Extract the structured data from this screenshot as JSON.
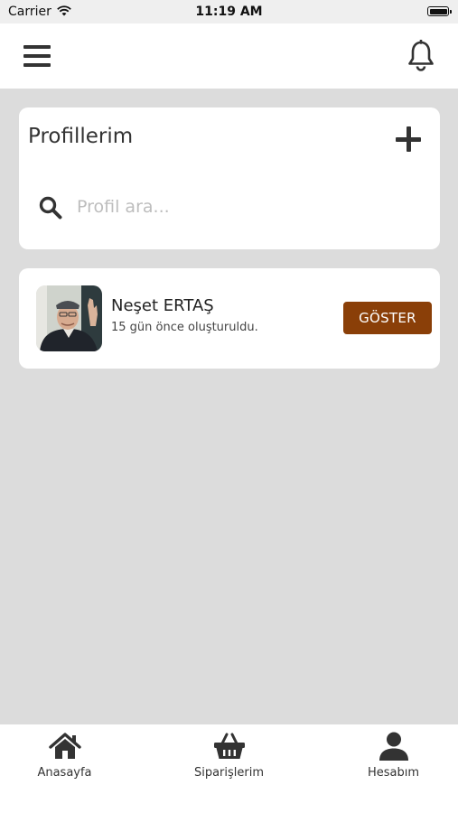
{
  "status_bar": {
    "carrier": "Carrier",
    "time": "11:19 AM"
  },
  "header": {
    "menu_icon": "menu-icon",
    "notification_icon": "bell-icon"
  },
  "profiles": {
    "title": "Profillerim",
    "search_placeholder": "Profil ara...",
    "add_icon": "plus-icon",
    "search_icon": "search-icon"
  },
  "profile_list": [
    {
      "name": "Neşet ERTAŞ",
      "subtitle": "15 gün önce oluşturuldu.",
      "button_label": "GÖSTER"
    }
  ],
  "tab_bar": {
    "items": [
      {
        "label": "Anasayfa",
        "icon": "home-icon"
      },
      {
        "label": "Siparişlerim",
        "icon": "basket-icon"
      },
      {
        "label": "Hesabım",
        "icon": "user-icon"
      }
    ]
  },
  "colors": {
    "accent": "#8a3f08",
    "background": "#dcdcdc",
    "card": "#ffffff",
    "text": "#333333"
  }
}
